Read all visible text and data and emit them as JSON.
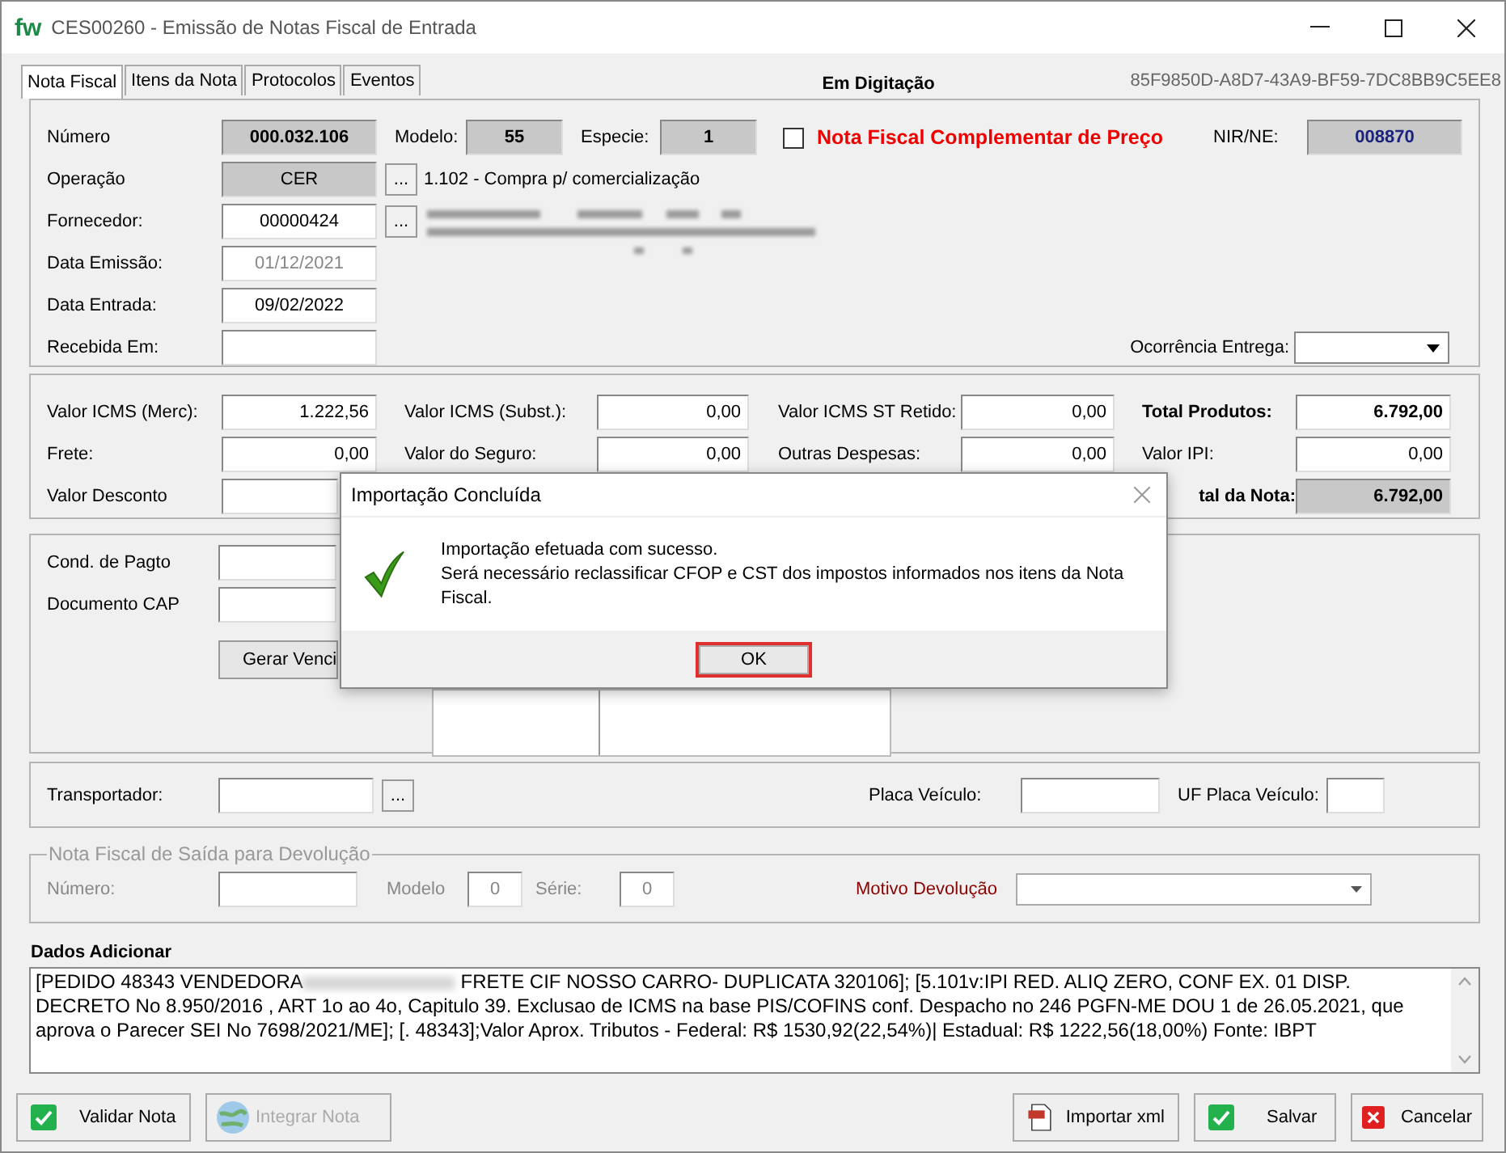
{
  "window": {
    "logo": "fw",
    "title": "CES00260 - Emissão de  Notas  Fiscal de Entrada"
  },
  "tabs": [
    {
      "label": "Nota Fiscal",
      "selected": true
    },
    {
      "label": "Itens da Nota",
      "selected": false
    },
    {
      "label": "Protocolos",
      "selected": false
    },
    {
      "label": "Eventos",
      "selected": false
    }
  ],
  "status": "Em Digitação",
  "guid": "85F9850D-A8D7-43A9-BF59-7DC8BB9C5EE8",
  "header": {
    "numero": {
      "label": "Número",
      "value": "000.032.106"
    },
    "modelo": {
      "label": "Modelo:",
      "value": "55"
    },
    "especie": {
      "label": "Especie:",
      "value": "1"
    },
    "complementar": {
      "label": "Nota Fiscal Complementar de Preço",
      "checked": false
    },
    "nir": {
      "label": "NIR/NE:",
      "value": "008870"
    },
    "operacao": {
      "label": "Operação",
      "value": "CER",
      "button": "...",
      "description": "1.102 - Compra p/ comercialização"
    },
    "fornecedor": {
      "label": "Fornecedor:",
      "value": "00000424",
      "button": "..."
    },
    "data_emissao": {
      "label": "Data Emissão:",
      "value": "01/12/2021",
      "disabled": true
    },
    "data_entrada": {
      "label": "Data Entrada:",
      "value": "09/02/2022",
      "disabled": false
    },
    "recebida": {
      "label": "Recebida Em:"
    },
    "ocorrencia": {
      "label": "Ocorrência Entrega:"
    }
  },
  "values": [
    [
      {
        "label": "Valor ICMS (Merc):",
        "value": "1.222,56"
      },
      {
        "label": "Valor  ICMS (Subst.):",
        "value": "0,00"
      },
      {
        "label": "Valor ICMS ST Retido:",
        "value": "0,00"
      },
      {
        "label": "Total Produtos:",
        "value": "6.792,00",
        "kind": "total"
      }
    ],
    [
      {
        "label": "Frete:",
        "value": "0,00"
      },
      {
        "label": "Valor do Seguro:",
        "value": "0,00"
      },
      {
        "label": "Outras Despesas:",
        "value": "0,00"
      },
      {
        "label": "Valor IPI:",
        "value": "0,00"
      }
    ],
    [
      {
        "label": "Valor Desconto",
        "kind": "covered"
      },
      {
        "label": "tal da Nota:",
        "value": "6.792,00",
        "kind": "total_readonly"
      }
    ]
  ],
  "payment": {
    "cond_label": "Cond. de Pagto",
    "doc_label": "Documento CAP",
    "button": "Gerar Venci"
  },
  "transport": {
    "label": "Transportador:",
    "button": "...",
    "placa_label": "Placa Veículo:",
    "uf_label": "UF Placa Veículo:"
  },
  "devolucao": {
    "title": "Nota Fiscal de Saída para Devolução",
    "numero_label": "Número:",
    "modelo_label": "Modelo",
    "modelo_value": "0",
    "serie_label": "Série:",
    "serie_value": "0",
    "motivo_label": "Motivo Devolução"
  },
  "dados": {
    "label": "Dados Adicionar",
    "text_before": "[PEDIDO 48343 VENDEDORA",
    "text_after": " FRETE CIF NOSSO CARRO- DUPLICATA 320106];  [5.101v:IPI RED. ALIQ ZERO, CONF EX. 01 DISP. DECRETO No 8.950/2016 , ART 1o ao 4o, Capitulo 39. Exclusao de ICMS na base PIS/COFINS conf. Despacho no 246 PGFN-ME DOU 1 de 26.05.2021, que aprova o Parecer SEI No 7698/2021/ME];  [. 48343];Valor Aprox. Tributos -  Federal: R$ 1530,92(22,54%)|  Estadual: R$ 1222,56(18,00%) Fonte: IBPT"
  },
  "buttons": [
    {
      "label": "Validar Nota",
      "kind": "confirm",
      "disabled": false
    },
    {
      "label": "Integrar Nota",
      "kind": "integrate",
      "disabled": true
    },
    {
      "label": "Importar xml",
      "kind": "import",
      "disabled": false
    },
    {
      "label": "Salvar",
      "kind": "confirm",
      "disabled": false
    },
    {
      "label": "Cancelar",
      "kind": "cancel",
      "disabled": false
    }
  ],
  "dialog": {
    "title": "Importação Concluída",
    "lines": [
      "Importação efetuada com sucesso.",
      "Será necessário reclassificar CFOP e CST dos impostos informados nos itens da Nota Fiscal."
    ],
    "button": "OK"
  }
}
